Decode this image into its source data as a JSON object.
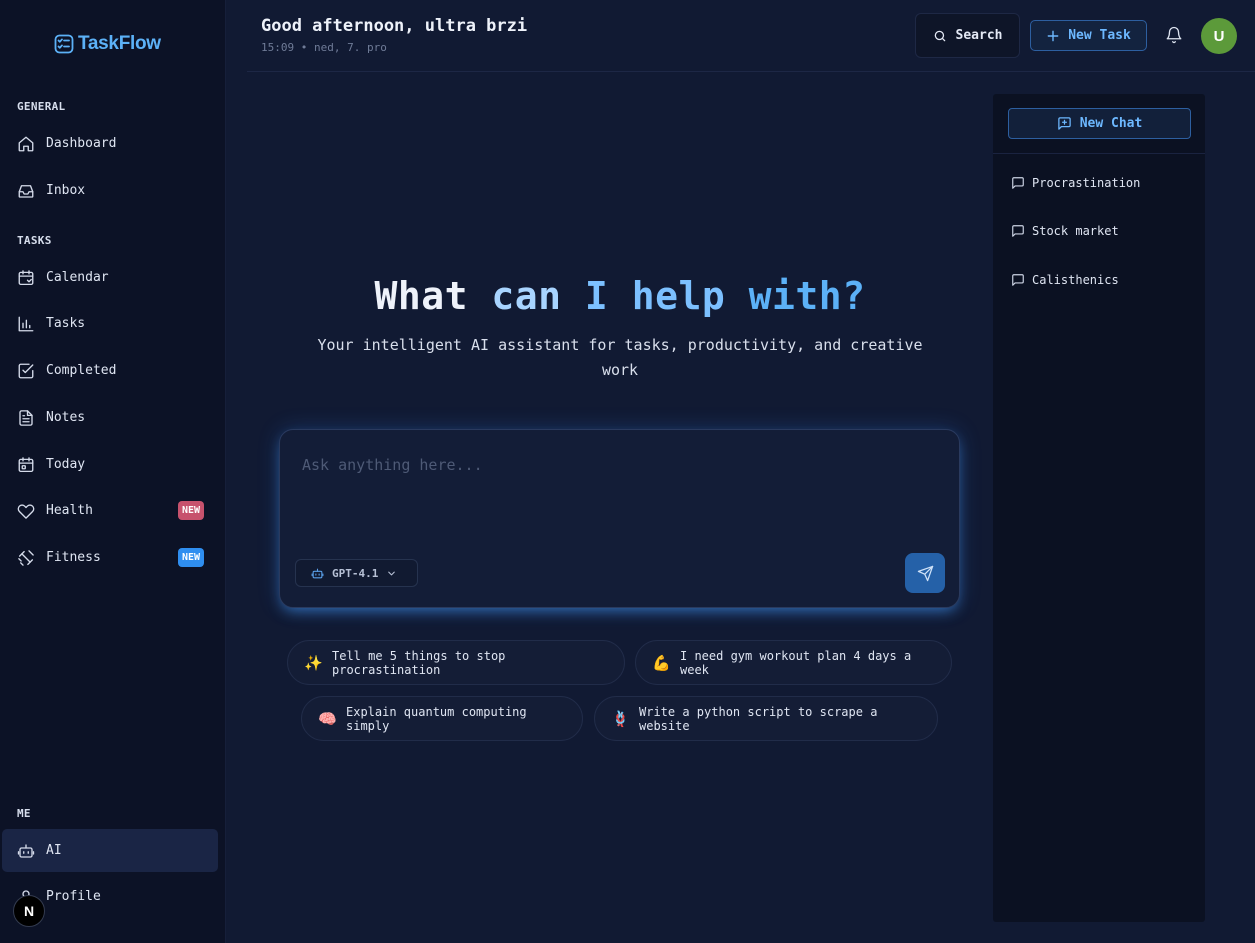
{
  "app": {
    "name": "TaskFlow"
  },
  "sidebar": {
    "sections": {
      "general": "GENERAL",
      "tasks": "TASKS",
      "me": "ME"
    },
    "items": {
      "dashboard": "Dashboard",
      "inbox": "Inbox",
      "calendar": "Calendar",
      "tasks": "Tasks",
      "completed": "Completed",
      "notes": "Notes",
      "today": "Today",
      "health": "Health",
      "fitness": "Fitness",
      "ai": "AI",
      "profile": "Profile"
    },
    "badges": {
      "health": "NEW",
      "fitness": "NEW"
    },
    "active_item": "ai",
    "dev_badge": "N"
  },
  "header": {
    "greeting": "Good afternoon, ultra brzi",
    "datetime": "15:09 • ned, 7. pro",
    "search_label": "Search",
    "new_task_label": "New Task",
    "avatar_initial": "U"
  },
  "hero": {
    "title_words": [
      "What",
      "can",
      "I",
      "help",
      "with?"
    ],
    "subtitle": "Your intelligent AI assistant for tasks, productivity, and creative work"
  },
  "prompt": {
    "placeholder": "Ask anything here...",
    "model": "GPT-4.1"
  },
  "suggestions": [
    {
      "emoji": "✨",
      "text": "Tell me 5 things to stop procrastination"
    },
    {
      "emoji": "💪",
      "text": "I need gym workout plan 4 days a week"
    },
    {
      "emoji": "🧠",
      "text": "Explain quantum computing simply"
    },
    {
      "emoji": "🪢",
      "text": "Write a python script to scrape a website"
    }
  ],
  "chat_panel": {
    "new_chat_label": "New Chat",
    "chats": [
      "Procrastination",
      "Stock market",
      "Calisthenics"
    ]
  },
  "colors": {
    "accent": "#5cb1f7",
    "background": "#111a33",
    "sidebar": "#0c1226",
    "badge_pink": "#c7526d",
    "badge_blue": "#2f8ef0"
  }
}
